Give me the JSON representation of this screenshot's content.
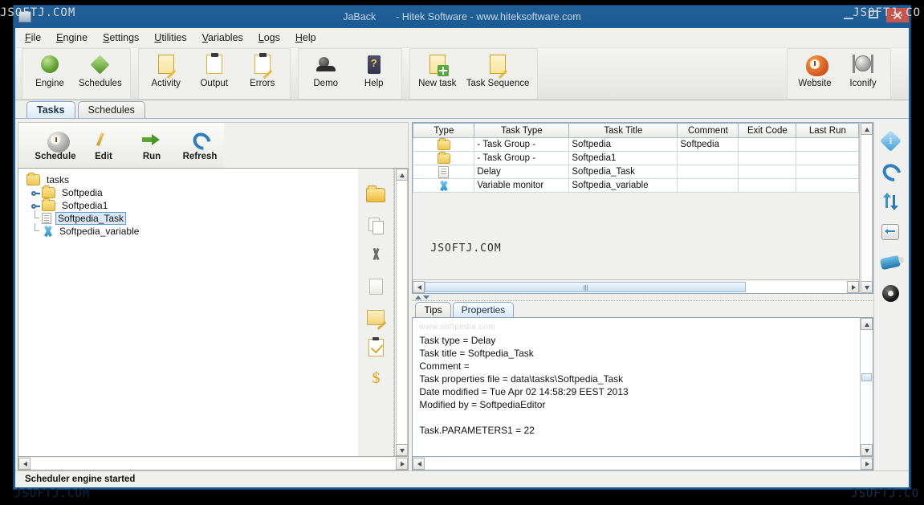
{
  "window": {
    "title": "JaBack",
    "subtitle": "- Hitek Software - www.hiteksoftware.com",
    "controls": {
      "minimize": "minimize",
      "maximize": "maximize",
      "close": "close"
    }
  },
  "watermarks": {
    "top_left": "JSOFTJ.COM",
    "top_right": "JSOFTJ.CO",
    "bottom_left": "JSOFTJ.COM",
    "bottom_right": "JSOFTJ.CO",
    "table": "JSOFTJ.COM",
    "properties": "www.softpedia.com"
  },
  "menubar": [
    {
      "label": "File",
      "accel": "F"
    },
    {
      "label": "Engine",
      "accel": "E"
    },
    {
      "label": "Settings",
      "accel": "S"
    },
    {
      "label": "Utilities",
      "accel": "U"
    },
    {
      "label": "Variables",
      "accel": "V"
    },
    {
      "label": "Logs",
      "accel": "L"
    },
    {
      "label": "Help",
      "accel": "H"
    }
  ],
  "toolbar": {
    "groups": [
      {
        "buttons": [
          {
            "label": "Engine",
            "icon": "green-sphere-icon"
          },
          {
            "label": "Schedules",
            "icon": "green-diamond-icon"
          }
        ]
      },
      {
        "buttons": [
          {
            "label": "Activity",
            "icon": "notepad-pencil-icon"
          },
          {
            "label": "Output",
            "icon": "clipboard-icon"
          },
          {
            "label": "Errors",
            "icon": "clipboard-magnifier-icon"
          }
        ]
      },
      {
        "buttons": [
          {
            "label": "Demo",
            "icon": "webcam-icon"
          },
          {
            "label": "Help",
            "icon": "help-book-icon"
          }
        ]
      },
      {
        "buttons": [
          {
            "label": "New task",
            "icon": "new-task-icon"
          },
          {
            "label": "Task Sequence",
            "icon": "task-sequence-icon"
          }
        ]
      }
    ],
    "right_group": [
      {
        "label": "Website",
        "icon": "orange-clock-icon"
      },
      {
        "label": "Iconify",
        "icon": "gray-clock-icon"
      }
    ]
  },
  "main_tabs": [
    {
      "label": "Tasks",
      "active": true
    },
    {
      "label": "Schedules",
      "active": false
    }
  ],
  "left_panel": {
    "toolbar": [
      {
        "label": "Schedule",
        "icon": "schedule-clock-icon"
      },
      {
        "label": "Edit",
        "icon": "pencil-icon"
      },
      {
        "label": "Run",
        "icon": "green-arrow-icon"
      },
      {
        "label": "Refresh",
        "icon": "blue-refresh-icon"
      }
    ],
    "tree": [
      {
        "label": "tasks",
        "icon": "folder-icon",
        "depth": 0,
        "handle": false,
        "selected": false
      },
      {
        "label": "Softpedia",
        "icon": "folder-icon",
        "depth": 1,
        "handle": true,
        "selected": false
      },
      {
        "label": "Softpedia1",
        "icon": "folder-icon",
        "depth": 1,
        "handle": true,
        "selected": false
      },
      {
        "label": "Softpedia_Task",
        "icon": "document-icon",
        "depth": 1,
        "handle": false,
        "selected": true
      },
      {
        "label": "Softpedia_variable",
        "icon": "variable-x-icon",
        "depth": 1,
        "handle": false,
        "selected": false
      }
    ]
  },
  "middle_strip": [
    {
      "icon": "new-folder-icon"
    },
    {
      "icon": "copy-icon"
    },
    {
      "icon": "cut-scissors-icon"
    },
    {
      "icon": "paste-icon"
    },
    {
      "icon": "edit-note-icon"
    },
    {
      "icon": "checklist-icon"
    },
    {
      "icon": "dollar-icon"
    }
  ],
  "right_rail": [
    {
      "icon": "info-icon"
    },
    {
      "icon": "refresh-icon"
    },
    {
      "icon": "sort-arrows-icon"
    },
    {
      "icon": "resize-width-icon"
    },
    {
      "icon": "usb-drive-icon"
    },
    {
      "icon": "disc-icon"
    }
  ],
  "table": {
    "columns": [
      "Type",
      "Task Type",
      "Task Title",
      "Comment",
      "Exit Code",
      "Last Run"
    ],
    "rows": [
      {
        "type_icon": "folder-icon",
        "task_type": "- Task Group -",
        "task_title": "Softpedia",
        "comment": "Softpedia",
        "exit_code": "",
        "last_run": ""
      },
      {
        "type_icon": "folder-icon",
        "task_type": "- Task Group -",
        "task_title": "Softpedia1",
        "comment": "",
        "exit_code": "",
        "last_run": ""
      },
      {
        "type_icon": "document-icon",
        "task_type": "Delay",
        "task_title": "Softpedia_Task",
        "comment": "",
        "exit_code": "",
        "last_run": ""
      },
      {
        "type_icon": "variable-x-icon",
        "task_type": "Variable monitor",
        "task_title": "Softpedia_variable",
        "comment": "",
        "exit_code": "",
        "last_run": ""
      }
    ]
  },
  "properties_panel": {
    "tabs": [
      {
        "label": "Tips",
        "active": false
      },
      {
        "label": "Properties",
        "active": true
      }
    ],
    "lines": [
      "Task type = Delay",
      "Task title = Softpedia_Task",
      "Comment =",
      "Task properties file = data\\tasks\\Softpedia_Task",
      "Date modified = Tue Apr 02 14:58:29 EEST 2013",
      "Modified by = SoftpediaEditor",
      "",
      "Task.PARAMETERS1 = 22"
    ]
  },
  "statusbar": {
    "text": "Scheduler engine started"
  }
}
